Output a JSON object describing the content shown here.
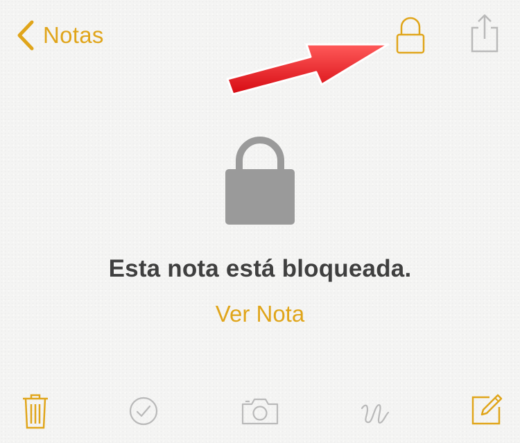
{
  "nav": {
    "back_label": "Notas",
    "back_icon": "chevron-left-icon",
    "lock_icon": "lock-icon",
    "share_icon": "share-icon"
  },
  "locked": {
    "title": "Esta nota está bloqueada.",
    "view_label": "Ver Nota"
  },
  "toolbar": {
    "icons": [
      "trash-icon",
      "checklist-icon",
      "camera-icon",
      "sketch-icon",
      "compose-icon"
    ]
  },
  "colors": {
    "accent": "#e0a51a",
    "disabled": "#b9b9b9",
    "lock_body": "#9a9a9a",
    "title": "#3f3f3f",
    "arrow": "#e8141c",
    "background": "#f4f4f3"
  }
}
